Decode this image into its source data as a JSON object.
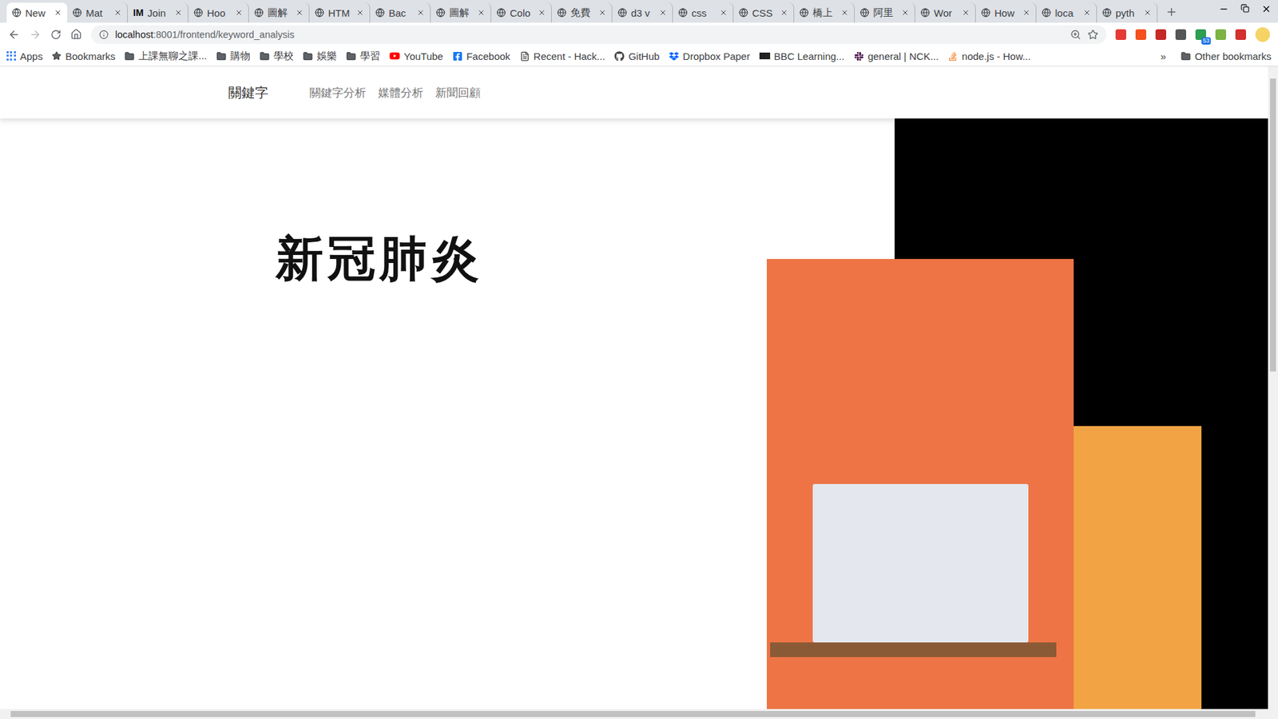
{
  "window": {
    "title": "New"
  },
  "tabs": [
    {
      "label": "New",
      "selected": true
    },
    {
      "label": "Mat",
      "selected": false
    },
    {
      "label": "Join",
      "selected": false,
      "badge": "IM"
    },
    {
      "label": "Hoo",
      "selected": false
    },
    {
      "label": "圖解",
      "selected": false
    },
    {
      "label": "HTM",
      "selected": false
    },
    {
      "label": "Bac",
      "selected": false
    },
    {
      "label": "圖解",
      "selected": false
    },
    {
      "label": "Colo",
      "selected": false
    },
    {
      "label": "免費",
      "selected": false
    },
    {
      "label": "d3 v",
      "selected": false
    },
    {
      "label": "css",
      "selected": false
    },
    {
      "label": "CSS",
      "selected": false
    },
    {
      "label": "橋上",
      "selected": false
    },
    {
      "label": "阿里",
      "selected": false
    },
    {
      "label": "Wor",
      "selected": false
    },
    {
      "label": "How",
      "selected": false
    },
    {
      "label": "loca",
      "selected": false
    },
    {
      "label": "pyth",
      "selected": false
    }
  ],
  "address": {
    "host": "localhost",
    "path": ":8001/frontend/keyword_analysis"
  },
  "extensions": [
    {
      "color": "#e53935"
    },
    {
      "color": "#f4511e"
    },
    {
      "color": "#c62828"
    },
    {
      "color": "#555555"
    },
    {
      "color": "#2e9e4f",
      "badge": "53"
    },
    {
      "color": "#7cb342"
    },
    {
      "color": "#d32f2f"
    }
  ],
  "bookmarks": [
    {
      "label": "Apps",
      "kind": "apps"
    },
    {
      "label": "Bookmarks",
      "kind": "star"
    },
    {
      "label": "上課無聊之課...",
      "kind": "folder"
    },
    {
      "label": "購物",
      "kind": "folder"
    },
    {
      "label": "學校",
      "kind": "folder"
    },
    {
      "label": "娛樂",
      "kind": "folder"
    },
    {
      "label": "學習",
      "kind": "folder"
    },
    {
      "label": "YouTube",
      "kind": "youtube"
    },
    {
      "label": "Facebook",
      "kind": "facebook"
    },
    {
      "label": "Recent - Hack...",
      "kind": "doc"
    },
    {
      "label": "GitHub",
      "kind": "github"
    },
    {
      "label": "Dropbox Paper",
      "kind": "dropbox"
    },
    {
      "label": "BBC Learning...",
      "kind": "bbc"
    },
    {
      "label": "general | NCK...",
      "kind": "slack"
    },
    {
      "label": "node.js - How...",
      "kind": "stack"
    }
  ],
  "bookmarks_more": "»",
  "other_bookmarks": "Other bookmarks",
  "page": {
    "brand": "關鍵字",
    "nav": [
      {
        "label": "關鍵字分析",
        "selected": false
      },
      {
        "label": "媒體分析",
        "selected": false
      },
      {
        "label": "新聞回顧",
        "selected": false
      }
    ],
    "title": "新冠肺炎"
  }
}
